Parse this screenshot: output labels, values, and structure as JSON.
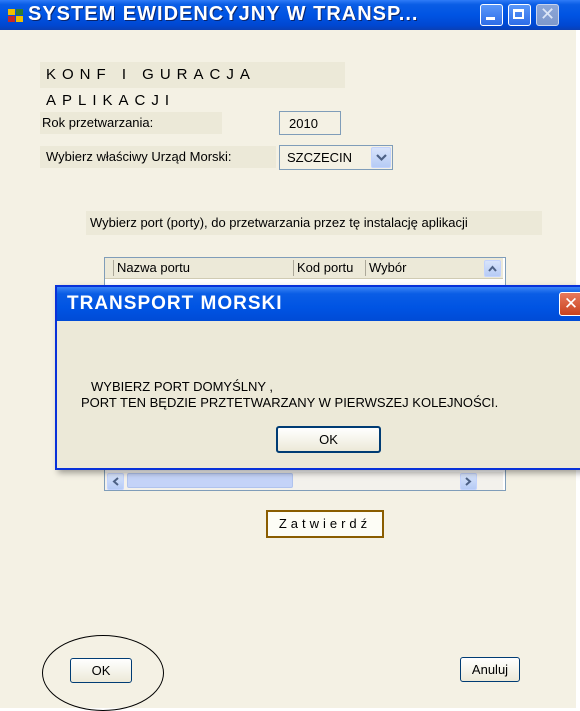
{
  "window": {
    "title": "SYSTEM  EWIDENCYJNY  W  TRANSP...",
    "title_bar_color": "#0054e3",
    "background_color": "#f4f1e4"
  },
  "form": {
    "heading": "KONF I GURACJA  APLIKACJI",
    "year_label": "Rok przetwarzania:",
    "year_value": "2010",
    "office_label": "Wybierz właściwy Urząd Morski:",
    "office_selected": "SZCZECIN",
    "instruction": "Wybierz port (porty), do przetwarzania przez tę instalację aplikacji"
  },
  "table": {
    "columns": [
      "Nazwa portu",
      "Kod portu",
      "Wybór"
    ],
    "rows": []
  },
  "buttons": {
    "confirm": "Zatwierdź",
    "ok": "OK",
    "cancel": "Anuluj"
  },
  "dialog": {
    "title": "TRANSPORT MORSKI",
    "line1": "WYBIERZ  PORT  DOMYŚLNY  ,",
    "line2": "PORT  TEN BĘDZIE  PRZTETWARZANY  W  PIERWSZEJ  KOLEJNOŚCI.",
    "ok": "OK",
    "close_color": "#c9421e"
  },
  "annotation": {
    "circle_color": "#000000"
  }
}
